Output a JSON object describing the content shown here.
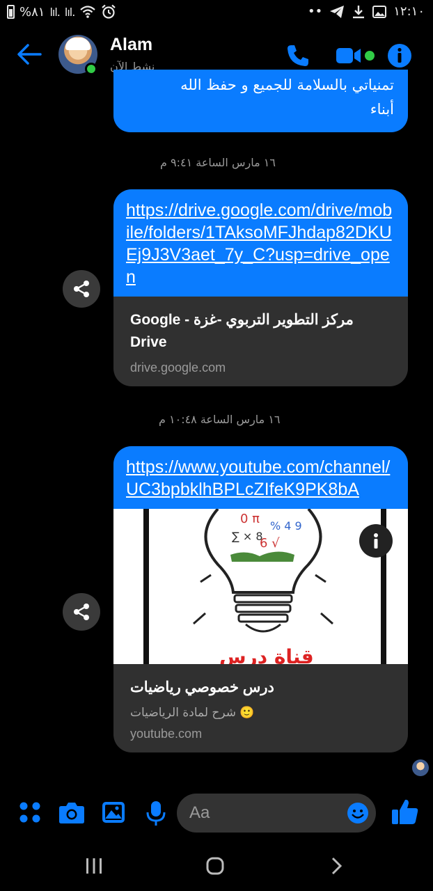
{
  "status_bar": {
    "battery": "%٨١",
    "time": "١٢:١٠",
    "signal1": "lıl.",
    "signal2": "lıl.",
    "dots": "••"
  },
  "header": {
    "contact_name": "Alam",
    "status": "نشط الآن"
  },
  "messages": {
    "top_bubble": {
      "line1": "تمنياتي بالسلامة للجميع و حفظ الله",
      "line2": "أبناء"
    },
    "timestamp1": "١٦ مارس الساعة ٩:٤١ م",
    "link1": {
      "url": "https://drive.google.com/drive/mobile/folders/1TAksoMFJhdap82DKUEj9J3V3aet_7y_C?usp=drive_open",
      "title": "مركز التطوير التربوي -غزة - Google Drive",
      "domain": "drive.google.com"
    },
    "timestamp2": "١٦ مارس الساعة ١٠:٤٨ م",
    "link2": {
      "url": "https://www.youtube.com/channel/UC3bpbklhBPLcZIfeK9PK8bA",
      "thumb_caption": "قناة درس",
      "title": "درس خصوصي رياضيات",
      "desc": "🙂 شرح لمادة الرياضيات",
      "domain": "youtube.com"
    }
  },
  "composer": {
    "placeholder": "Aa"
  },
  "colors": {
    "accent": "#0a7cff",
    "background": "#000000",
    "card": "#303030",
    "online": "#31cc46"
  },
  "icons": [
    "back-arrow-icon",
    "phone-icon",
    "video-camera-icon",
    "info-icon",
    "share-icon",
    "apps-grid-icon",
    "camera-icon",
    "gallery-icon",
    "microphone-icon",
    "emoji-icon",
    "thumbs-up-icon",
    "recent-apps-icon",
    "home-icon",
    "back-nav-icon"
  ]
}
